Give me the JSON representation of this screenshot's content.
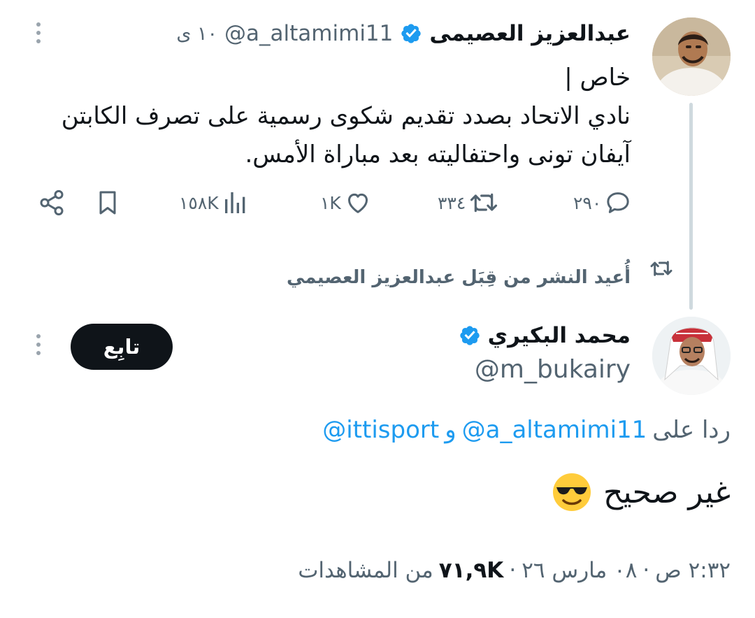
{
  "tweet1": {
    "display_name": "عبدالعزيز العصيمى",
    "handle": "@a_altamimi11",
    "time": "١٠ ى",
    "text_lines": [
      "خاص |",
      "نادي الاتحاد بصدد تقديم شكوى رسمية على تصرف الكابتن",
      "آيفان تونى واحتفاليته بعد مباراة الأمس."
    ],
    "stats": {
      "replies": "٢٩٠",
      "reposts": "٣٣٤",
      "likes": "١K",
      "views": "١٥٨K"
    },
    "icons": {
      "verified": "verified-badge-icon",
      "reply": "reply-icon",
      "repost": "repost-icon",
      "like": "heart-icon",
      "views": "views-chart-icon",
      "bookmark": "bookmark-icon",
      "share": "share-icon",
      "more": "more-vertical-icon"
    }
  },
  "repost_label": {
    "text": "أُعيد النشر من قِبَل عبدالعزيز العصيمي",
    "icon": "repost-icon"
  },
  "tweet2": {
    "display_name": "محمد البكيري",
    "handle": "@m_bukairy",
    "follow_label": "تابِع",
    "reply_prefix": "ردا على",
    "mention1": "@a_altamimi11",
    "conjunction": "و",
    "mention2": "@ittisport",
    "text": "غير صحيح",
    "emoji": "smiling-face-with-sunglasses",
    "meta": {
      "time": "٢:٣٢ ص",
      "separator1": "·",
      "date": "٠٨ مارس ٢٦",
      "separator2": "·",
      "views_count": "٧١,٩K",
      "views_label": "من المشاهدات"
    }
  },
  "colors": {
    "accent": "#1d9bf0",
    "text": "#0f1419",
    "secondary": "#536471",
    "thread_line": "#cfd9de",
    "follow_button": "#0f1419"
  }
}
